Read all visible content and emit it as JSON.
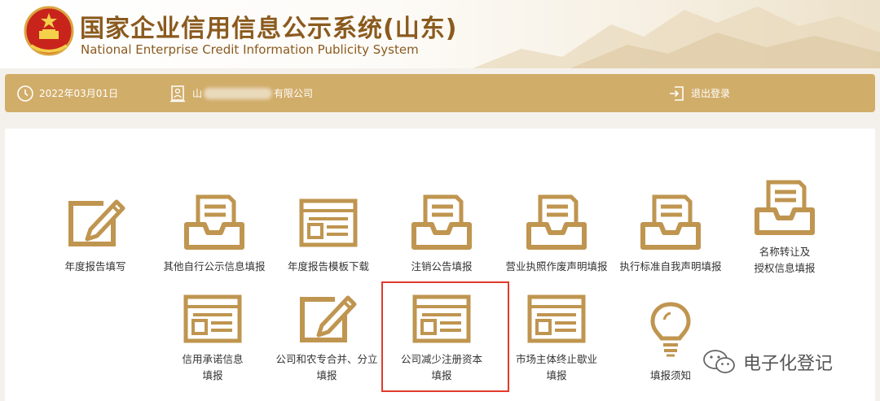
{
  "header": {
    "title_cn": "国家企业信用信息公示系统(山东)",
    "title_en": "National Enterprise Credit Information Publicity System"
  },
  "topbar": {
    "date": "2022年03月01日",
    "company_prefix": "山",
    "company_suffix": "有限公司",
    "logout": "退出登录"
  },
  "tiles": [
    {
      "icon": "pencil",
      "line1": "年度报告填写",
      "line2": ""
    },
    {
      "icon": "tray",
      "line1": "其他自行公示信息填报",
      "line2": ""
    },
    {
      "icon": "form",
      "line1": "年度报告模板下载",
      "line2": ""
    },
    {
      "icon": "tray",
      "line1": "注销公告填报",
      "line2": ""
    },
    {
      "icon": "tray",
      "line1": "营业执照作废声明填报",
      "line2": ""
    },
    {
      "icon": "tray",
      "line1": "执行标准自我声明填报",
      "line2": ""
    },
    {
      "icon": "tray",
      "line1": "名称转让及",
      "line2": "授权信息填报"
    },
    {
      "icon": "form",
      "line1": "信用承诺信息",
      "line2": "填报"
    },
    {
      "icon": "pencil",
      "line1": "公司和农专合并、分立",
      "line2": "填报"
    },
    {
      "icon": "form",
      "line1": "公司减少注册资本",
      "line2": "填报"
    },
    {
      "icon": "form",
      "line1": "市场主体终止歇业",
      "line2": "填报"
    },
    {
      "icon": "bulb",
      "line1": "填报须知",
      "line2": ""
    }
  ],
  "watermark": "电子化登记",
  "colors": {
    "brand": "#8a5a1e",
    "bar": "#d1ad6a",
    "icon": "#bf9550",
    "highlight": "#e23a2c"
  }
}
